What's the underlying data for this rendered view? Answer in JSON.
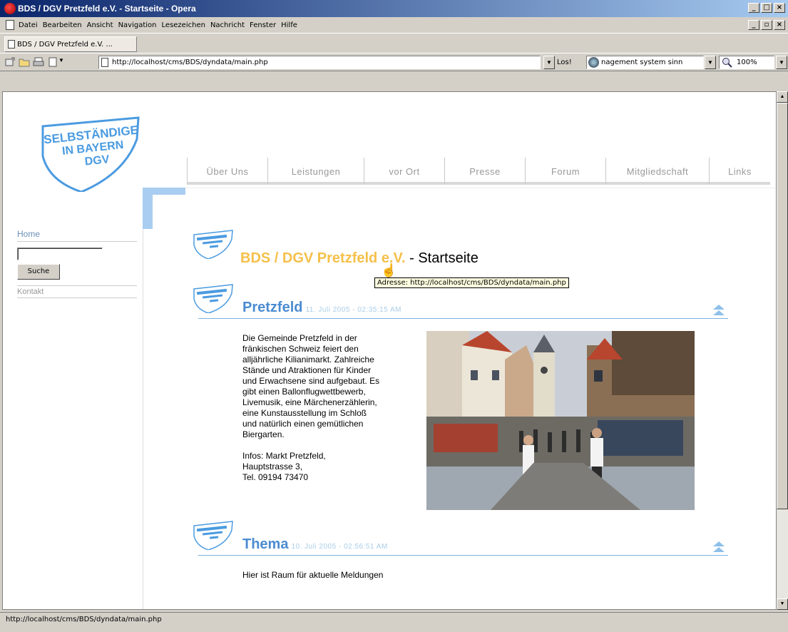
{
  "window": {
    "title": "BDS / DGV Pretzfeld e.V. - Startseite - Opera"
  },
  "menu": {
    "items": [
      "Datei",
      "Bearbeiten",
      "Ansicht",
      "Navigation",
      "Lesezeichen",
      "Nachricht",
      "Fenster",
      "Hilfe"
    ]
  },
  "tabs": [
    {
      "label": "BDS / DGV Pretzfeld e.V. ..."
    }
  ],
  "toolbar": {
    "address": "http://localhost/cms/BDS/dyndata/main.php",
    "go_label": "Los!",
    "search_value": "nagement system sinn",
    "zoom": "100%"
  },
  "page": {
    "logo_text": [
      "SELBSTÄNDIGE",
      "IN BAYERN",
      "DGV"
    ],
    "nav": [
      "Über Uns",
      "Leistungen",
      "vor Ort",
      "Presse",
      "Forum",
      "Mitgliedschaft",
      "Links"
    ],
    "sidebar": {
      "home": "Home",
      "search_button": "Suche",
      "kontakt": "Kontakt"
    },
    "title_org": "BDS / DGV Pretzfeld e.V.",
    "title_sep": " - Startseite",
    "tooltip": "Adresse: http://localhost/cms/BDS/dyndata/main.php",
    "articles": [
      {
        "title": "Pretzfeld",
        "date": "11. Juli 2005 - 02:35:15 AM",
        "body": [
          "Die Gemeinde Pretzfeld in der",
          "fränkischen Schweiz feiert den",
          "alljährliche Kilianimarkt. Zahlreiche",
          "Stände und Atraktionen für Kinder",
          "und Erwachsene sind aufgebaut. Es",
          "gibt einen Ballonflugwettbewerb,",
          "Livemusik, eine Märchenerzählerin,",
          "eine Kunstausstellung im Schloß",
          "und natürlich einen gemütlichen",
          "Biergarten."
        ],
        "info": [
          "Infos: Markt Pretzfeld,",
          "Hauptstrasse 3,",
          "Tel. 09194 73470"
        ]
      },
      {
        "title": "Thema",
        "date": "10. Juli 2005 - 02:56:51 AM",
        "body": [
          "Hier ist Raum für aktuelle Meldungen"
        ]
      }
    ]
  },
  "status": {
    "text": "http://localhost/cms/BDS/dyndata/main.php"
  },
  "colors": {
    "accent_blue": "#4b8bd0",
    "org_yellow": "#f5c04a",
    "light_blue": "#a9cdf0"
  }
}
